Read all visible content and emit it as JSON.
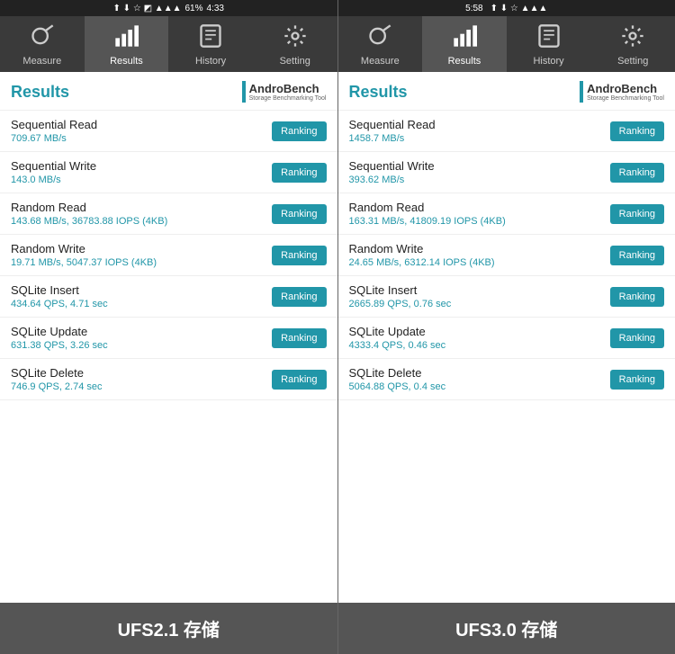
{
  "left_phone": {
    "status_bar": {
      "time": "4:33",
      "battery": "61%"
    },
    "nav": {
      "items": [
        {
          "id": "measure",
          "label": "Measure",
          "active": false
        },
        {
          "id": "results",
          "label": "Results",
          "active": true
        },
        {
          "id": "history",
          "label": "History",
          "active": false
        },
        {
          "id": "setting",
          "label": "Setting",
          "active": false
        }
      ]
    },
    "results": {
      "title": "Results",
      "logo_main": "AndroBench",
      "logo_sub": "Storage Benchmarking Tool",
      "rows": [
        {
          "name": "Sequential Read",
          "value": "709.67 MB/s"
        },
        {
          "name": "Sequential Write",
          "value": "143.0 MB/s"
        },
        {
          "name": "Random Read",
          "value": "143.68 MB/s, 36783.88 IOPS (4KB)"
        },
        {
          "name": "Random Write",
          "value": "19.71 MB/s, 5047.37 IOPS (4KB)"
        },
        {
          "name": "SQLite Insert",
          "value": "434.64 QPS, 4.71 sec"
        },
        {
          "name": "SQLite Update",
          "value": "631.38 QPS, 3.26 sec"
        },
        {
          "name": "SQLite Delete",
          "value": "746.9 QPS, 2.74 sec"
        }
      ],
      "ranking_label": "Ranking"
    },
    "footer": "UFS2.1 存储"
  },
  "right_phone": {
    "status_bar": {
      "time": "5:58"
    },
    "nav": {
      "items": [
        {
          "id": "measure",
          "label": "Measure",
          "active": false
        },
        {
          "id": "results",
          "label": "Results",
          "active": true
        },
        {
          "id": "history",
          "label": "History",
          "active": false
        },
        {
          "id": "setting",
          "label": "Setting",
          "active": false
        }
      ]
    },
    "results": {
      "title": "Results",
      "logo_main": "AndroBench",
      "logo_sub": "Storage Benchmarking Tool",
      "rows": [
        {
          "name": "Sequential Read",
          "value": "1458.7 MB/s"
        },
        {
          "name": "Sequential Write",
          "value": "393.62 MB/s"
        },
        {
          "name": "Random Read",
          "value": "163.31 MB/s, 41809.19 IOPS (4KB)"
        },
        {
          "name": "Random Write",
          "value": "24.65 MB/s, 6312.14 IOPS (4KB)"
        },
        {
          "name": "SQLite Insert",
          "value": "2665.89 QPS, 0.76 sec"
        },
        {
          "name": "SQLite Update",
          "value": "4333.4 QPS, 0.46 sec"
        },
        {
          "name": "SQLite Delete",
          "value": "5064.88 QPS, 0.4 sec"
        }
      ],
      "ranking_label": "Ranking"
    },
    "footer": "UFS3.0 存储"
  }
}
